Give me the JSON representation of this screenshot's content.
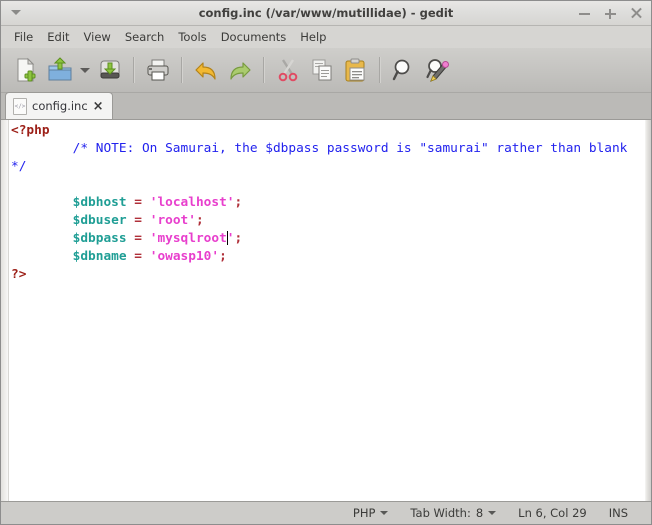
{
  "window": {
    "title": "config.inc (/var/www/mutillidae) - gedit",
    "controls": {
      "minimize": "minimize",
      "maximize": "maximize",
      "close": "close"
    }
  },
  "menubar": {
    "items": [
      {
        "label": "File"
      },
      {
        "label": "Edit"
      },
      {
        "label": "View"
      },
      {
        "label": "Search"
      },
      {
        "label": "Tools"
      },
      {
        "label": "Documents"
      },
      {
        "label": "Help"
      }
    ]
  },
  "toolbar": {
    "buttons": [
      {
        "name": "new-document",
        "icon": "new-file-icon"
      },
      {
        "name": "open-document",
        "icon": "open-folder-icon"
      },
      {
        "name": "open-dropdown",
        "icon": "chevron-down-icon"
      },
      {
        "name": "save-document",
        "icon": "save-icon"
      },
      {
        "name": "print-document",
        "icon": "print-icon"
      },
      {
        "name": "undo",
        "icon": "undo-arrow-icon"
      },
      {
        "name": "redo",
        "icon": "redo-arrow-icon"
      },
      {
        "name": "cut",
        "icon": "scissors-icon"
      },
      {
        "name": "copy",
        "icon": "copy-icon"
      },
      {
        "name": "paste",
        "icon": "clipboard-paste-icon"
      },
      {
        "name": "find",
        "icon": "magnifier-icon"
      },
      {
        "name": "find-replace",
        "icon": "magnifier-pencil-icon"
      }
    ]
  },
  "tabs": [
    {
      "label": "config.inc",
      "close": "×",
      "icon_glyph": "</>"
    }
  ],
  "editor": {
    "lines": [
      {
        "id": 1,
        "tokens": [
          {
            "t": "php",
            "v": "<?php"
          }
        ]
      },
      {
        "id": 2,
        "tokens": [
          {
            "t": "plain",
            "v": "        "
          },
          {
            "t": "cmt",
            "v": "/* NOTE: On Samurai, the $dbpass password is \"samurai\" rather than blank */"
          }
        ]
      },
      {
        "id": 3,
        "tokens": []
      },
      {
        "id": 4,
        "tokens": [
          {
            "t": "plain",
            "v": "        "
          },
          {
            "t": "var",
            "v": "$dbhost"
          },
          {
            "t": "plain",
            "v": " "
          },
          {
            "t": "op",
            "v": "="
          },
          {
            "t": "plain",
            "v": " "
          },
          {
            "t": "str",
            "v": "'localhost'"
          },
          {
            "t": "op",
            "v": ";"
          }
        ]
      },
      {
        "id": 5,
        "tokens": [
          {
            "t": "plain",
            "v": "        "
          },
          {
            "t": "var",
            "v": "$dbuser"
          },
          {
            "t": "plain",
            "v": " "
          },
          {
            "t": "op",
            "v": "="
          },
          {
            "t": "plain",
            "v": " "
          },
          {
            "t": "str",
            "v": "'root'"
          },
          {
            "t": "op",
            "v": ";"
          }
        ]
      },
      {
        "id": 6,
        "tokens": [
          {
            "t": "plain",
            "v": "        "
          },
          {
            "t": "var",
            "v": "$dbpass"
          },
          {
            "t": "plain",
            "v": " "
          },
          {
            "t": "op",
            "v": "="
          },
          {
            "t": "plain",
            "v": " "
          },
          {
            "t": "str",
            "v": "'mysqlroot"
          },
          {
            "t": "caret",
            "v": ""
          },
          {
            "t": "str",
            "v": "'"
          },
          {
            "t": "op",
            "v": ";"
          }
        ]
      },
      {
        "id": 7,
        "tokens": [
          {
            "t": "plain",
            "v": "        "
          },
          {
            "t": "var",
            "v": "$dbname"
          },
          {
            "t": "plain",
            "v": " "
          },
          {
            "t": "op",
            "v": "="
          },
          {
            "t": "plain",
            "v": " "
          },
          {
            "t": "str",
            "v": "'owasp10'"
          },
          {
            "t": "op",
            "v": ";"
          }
        ]
      },
      {
        "id": 8,
        "tokens": [
          {
            "t": "php",
            "v": "?>"
          }
        ]
      }
    ],
    "colors": {
      "php_tag": "#9c1f17",
      "comment": "#2222ee",
      "variable": "#1f9e95",
      "operator": "#b0303a",
      "string": "#e83fcd",
      "background": "#ffffff"
    }
  },
  "statusbar": {
    "language": "PHP",
    "tab_width_label": "Tab Width:",
    "tab_width_value": "8",
    "position": "Ln 6, Col 29",
    "insert_mode": "INS"
  }
}
